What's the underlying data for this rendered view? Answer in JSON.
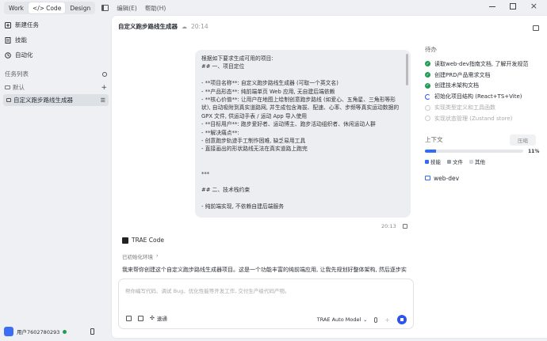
{
  "topbar": {
    "modes": [
      "Work",
      "Code",
      "Design"
    ],
    "menu": [
      "编辑(E)",
      "帮助(H)"
    ]
  },
  "sidebar": {
    "nav": [
      "新建任务",
      "技能",
      "自动化"
    ],
    "task_list_label": "任务列表",
    "group_label": "默认",
    "task_label": "自定义跑步路线生成器",
    "user_name": "用户7602780293"
  },
  "header": {
    "title": "自定义跑步路线生成器",
    "time": "20:14"
  },
  "message": {
    "lines": [
      "根据如下要求生成可用的项目:",
      "## 一、项目定位",
      "",
      "- **项目名称**: 自定义跑步路线生成器 (可取一个英文名)",
      "- **产品形态**: 纯前端单页 Web 应用, 无自建后端依赖",
      "- **核心价值**: 让用户在地图上绘制创意跑步路线 (如爱心、五角星、三角形等形",
      "状), 自动吸附到真实道路网, 并生成包含海拔、配速、心率、步频等真实运动数据的",
      "GPX 文件, 供运动手表 / 运动 App 导入使用",
      "- **目标用户**: 跑步爱好者、运动博主、跑步活动组织者、休闲运动人群",
      "- **解决痛点**:",
      "- 创意跑步轨迹手工制作困难, 缺乏易用工具",
      "- 直接画出的形状路线无法在真实道路上跑完",
      "",
      "",
      "***",
      "",
      "## 二、技术栈约束",
      "",
      "- 纯前端实现, 不依赖自建后端服务"
    ],
    "time": "20:13"
  },
  "reply": {
    "agent_name": "TRAE Code",
    "status": "已初始化环境",
    "text": "我来帮你创建这个自定义跑步路线生成器项目。这是一个功能丰富的纯前端应用, 让我先规划好整体架构, 然后逐步实"
  },
  "input": {
    "placeholder": "帮你编写代码、调试 Bug、优化性能等开发工作, 交付生产级代码产物。",
    "speed_label": "速通",
    "model": "TRAE Auto Model"
  },
  "todo": {
    "title": "待办",
    "items": [
      {
        "text": "读取web-dev指南文档, 了解开发规范",
        "state": "done"
      },
      {
        "text": "创建PRD产品需求文档",
        "state": "done"
      },
      {
        "text": "创建技术架构文档",
        "state": "done"
      },
      {
        "text": "初始化项目结构 (React+TS+Vite)",
        "state": "active"
      },
      {
        "text": "实现类型定义和工具函数",
        "state": "pending"
      },
      {
        "text": "实现状态管理 (Zustand store)",
        "state": "pending"
      }
    ]
  },
  "context": {
    "title": "上下文",
    "compress_label": "压缩",
    "progress": 0.11,
    "percent_label": "11%",
    "legend": [
      "技能",
      "文件",
      "其他"
    ],
    "skill": "web-dev"
  },
  "colors": {
    "accent": "#2f54eb",
    "done": "#1f9d55",
    "skill": "#2f6bff",
    "file": "#9aa3ad",
    "other": "#d3d7dc"
  }
}
